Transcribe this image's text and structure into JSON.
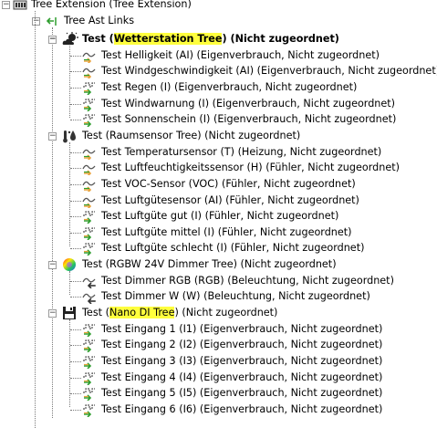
{
  "tree": {
    "root": {
      "label": "Tree Extension (Tree Extension)"
    },
    "links": {
      "label": "Tree Ast Links"
    },
    "groups": [
      {
        "name": "weather",
        "prefix": "Test (",
        "highlight": "Wetterstation Tree",
        "suffix": ") (Nicht zugeordnet)",
        "icon": "weather-icon",
        "bold": true,
        "children": [
          {
            "label": "Test Helligkeit (AI) (Eigenverbrauch, Nicht zugeordnet)",
            "icon": "analog-sensor-icon"
          },
          {
            "label": "Test Windgeschwindigkeit (AI) (Eigenverbrauch, Nicht zugeordnet)",
            "icon": "analog-sensor-icon"
          },
          {
            "label": "Test Regen (I) (Eigenverbrauch, Nicht zugeordnet)",
            "icon": "digital-input-icon"
          },
          {
            "label": "Test Windwarnung (I) (Eigenverbrauch, Nicht zugeordnet)",
            "icon": "digital-input-icon"
          },
          {
            "label": "Test Sonnenschein (I) (Eigenverbrauch, Nicht zugeordnet)",
            "icon": "digital-input-icon"
          }
        ]
      },
      {
        "name": "room",
        "prefix": "Test (Raumsensor Tree) (Nicht zugeordnet)",
        "highlight": "",
        "suffix": "",
        "icon": "room-sensor-icon",
        "bold": false,
        "children": [
          {
            "label": "Test Temperatursensor (T) (Heizung, Nicht zugeordnet)",
            "icon": "analog-sensor-icon"
          },
          {
            "label": "Test Luftfeuchtigkeitssensor (H) (Fühler, Nicht zugeordnet)",
            "icon": "analog-sensor-icon"
          },
          {
            "label": "Test VOC-Sensor (VOC) (Fühler, Nicht zugeordnet)",
            "icon": "analog-sensor-icon"
          },
          {
            "label": "Test Luftgütesensor (AI) (Fühler, Nicht zugeordnet)",
            "icon": "analog-sensor-icon"
          },
          {
            "label": "Test Luftgüte gut (I) (Fühler, Nicht zugeordnet)",
            "icon": "digital-input-icon"
          },
          {
            "label": "Test Luftgüte mittel (I) (Fühler, Nicht zugeordnet)",
            "icon": "digital-input-icon"
          },
          {
            "label": "Test Luftgüte schlecht (I) (Fühler, Nicht zugeordnet)",
            "icon": "digital-input-icon"
          }
        ]
      },
      {
        "name": "dimmer",
        "prefix": "Test (RGBW 24V Dimmer Tree) (Nicht zugeordnet)",
        "highlight": "",
        "suffix": "",
        "icon": "color-wheel-icon",
        "bold": false,
        "children": [
          {
            "label": "Test Dimmer RGB (RGB) (Beleuchtung, Nicht zugeordnet)",
            "icon": "dimmer-output-icon"
          },
          {
            "label": "Test Dimmer W (W) (Beleuchtung, Nicht zugeordnet)",
            "icon": "dimmer-output-icon"
          }
        ]
      },
      {
        "name": "nano",
        "prefix": "Test (",
        "highlight": "Nano DI Tree",
        "suffix": ") (Nicht zugeordnet)",
        "icon": "save-disk-icon",
        "bold": false,
        "children": [
          {
            "label": "Test Eingang 1 (I1) (Eigenverbrauch, Nicht zugeordnet)",
            "icon": "digital-input-icon"
          },
          {
            "label": "Test Eingang 2 (I2) (Eigenverbrauch, Nicht zugeordnet)",
            "icon": "digital-input-icon"
          },
          {
            "label": "Test Eingang 3 (I3) (Eigenverbrauch, Nicht zugeordnet)",
            "icon": "digital-input-icon"
          },
          {
            "label": "Test Eingang 4 (I4) (Eigenverbrauch, Nicht zugeordnet)",
            "icon": "digital-input-icon"
          },
          {
            "label": "Test Eingang 5 (I5) (Eigenverbrauch, Nicht zugeordnet)",
            "icon": "digital-input-icon"
          },
          {
            "label": "Test Eingang 6 (I6) (Eigenverbrauch, Nicht zugeordnet)",
            "icon": "digital-input-icon"
          }
        ]
      }
    ]
  },
  "colors": {
    "highlight": "#ffff3d",
    "tree_lines": "#7a7a7a",
    "green_arrow": "#2f9e2f",
    "orange_arrow": "#e8a23a"
  }
}
